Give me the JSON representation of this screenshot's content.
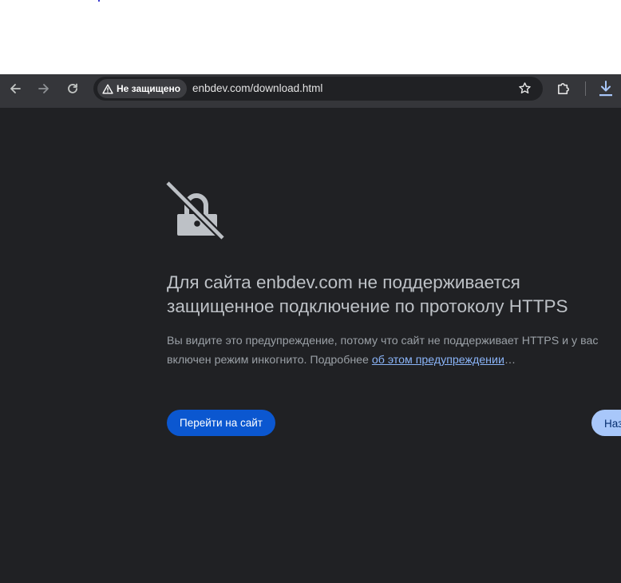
{
  "toolbar": {
    "back_icon": "arrow-left-icon",
    "forward_icon": "arrow-right-icon",
    "reload_icon": "reload-icon",
    "security_chip_label": "Не защищено",
    "url": "enbdev.com/download.html",
    "bookmark_icon": "star-icon",
    "extensions_icon": "puzzle-icon",
    "download_icon": "download-icon"
  },
  "interstitial": {
    "icon": "lock-crossed-icon",
    "heading": "Для сайта enbdev.com не поддерживается защищенное подключение по протоколу HTTPS",
    "desc_text": "Вы видите это предупреждение, потому что сайт не поддерживает HTTPS и у вас включен режим инкогнито. Подробнее ",
    "desc_link": "об этом предупреждении",
    "desc_ellipsis": "…",
    "proceed_label": "Перейти на сайт",
    "back_label": "Назад"
  },
  "colors": {
    "page_bg": "#202124",
    "toolbar_bg": "#35363a",
    "primary_button": "#0b57d0",
    "secondary_button": "#a8c7fa",
    "link": "#8ab4f8"
  }
}
